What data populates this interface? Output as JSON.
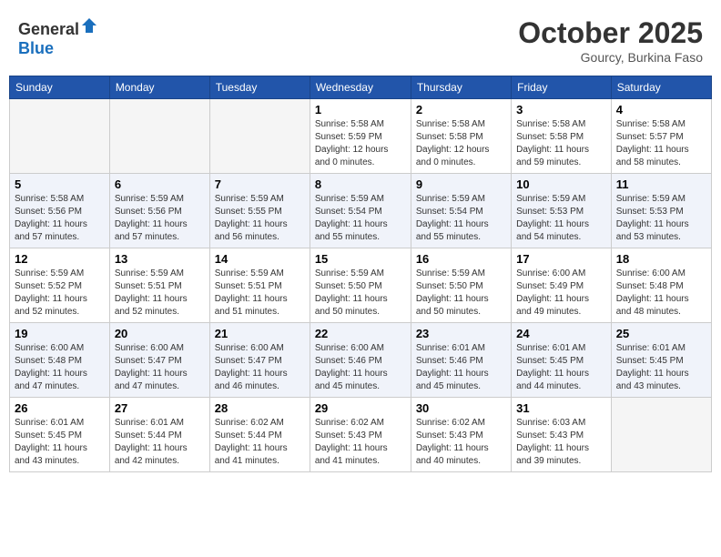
{
  "header": {
    "logo_general": "General",
    "logo_blue": "Blue",
    "month": "October 2025",
    "location": "Gourcy, Burkina Faso"
  },
  "weekdays": [
    "Sunday",
    "Monday",
    "Tuesday",
    "Wednesday",
    "Thursday",
    "Friday",
    "Saturday"
  ],
  "weeks": [
    [
      {
        "day": "",
        "info": ""
      },
      {
        "day": "",
        "info": ""
      },
      {
        "day": "",
        "info": ""
      },
      {
        "day": "1",
        "info": "Sunrise: 5:58 AM\nSunset: 5:59 PM\nDaylight: 12 hours\nand 0 minutes."
      },
      {
        "day": "2",
        "info": "Sunrise: 5:58 AM\nSunset: 5:58 PM\nDaylight: 12 hours\nand 0 minutes."
      },
      {
        "day": "3",
        "info": "Sunrise: 5:58 AM\nSunset: 5:58 PM\nDaylight: 11 hours\nand 59 minutes."
      },
      {
        "day": "4",
        "info": "Sunrise: 5:58 AM\nSunset: 5:57 PM\nDaylight: 11 hours\nand 58 minutes."
      }
    ],
    [
      {
        "day": "5",
        "info": "Sunrise: 5:58 AM\nSunset: 5:56 PM\nDaylight: 11 hours\nand 57 minutes."
      },
      {
        "day": "6",
        "info": "Sunrise: 5:59 AM\nSunset: 5:56 PM\nDaylight: 11 hours\nand 57 minutes."
      },
      {
        "day": "7",
        "info": "Sunrise: 5:59 AM\nSunset: 5:55 PM\nDaylight: 11 hours\nand 56 minutes."
      },
      {
        "day": "8",
        "info": "Sunrise: 5:59 AM\nSunset: 5:54 PM\nDaylight: 11 hours\nand 55 minutes."
      },
      {
        "day": "9",
        "info": "Sunrise: 5:59 AM\nSunset: 5:54 PM\nDaylight: 11 hours\nand 55 minutes."
      },
      {
        "day": "10",
        "info": "Sunrise: 5:59 AM\nSunset: 5:53 PM\nDaylight: 11 hours\nand 54 minutes."
      },
      {
        "day": "11",
        "info": "Sunrise: 5:59 AM\nSunset: 5:53 PM\nDaylight: 11 hours\nand 53 minutes."
      }
    ],
    [
      {
        "day": "12",
        "info": "Sunrise: 5:59 AM\nSunset: 5:52 PM\nDaylight: 11 hours\nand 52 minutes."
      },
      {
        "day": "13",
        "info": "Sunrise: 5:59 AM\nSunset: 5:51 PM\nDaylight: 11 hours\nand 52 minutes."
      },
      {
        "day": "14",
        "info": "Sunrise: 5:59 AM\nSunset: 5:51 PM\nDaylight: 11 hours\nand 51 minutes."
      },
      {
        "day": "15",
        "info": "Sunrise: 5:59 AM\nSunset: 5:50 PM\nDaylight: 11 hours\nand 50 minutes."
      },
      {
        "day": "16",
        "info": "Sunrise: 5:59 AM\nSunset: 5:50 PM\nDaylight: 11 hours\nand 50 minutes."
      },
      {
        "day": "17",
        "info": "Sunrise: 6:00 AM\nSunset: 5:49 PM\nDaylight: 11 hours\nand 49 minutes."
      },
      {
        "day": "18",
        "info": "Sunrise: 6:00 AM\nSunset: 5:48 PM\nDaylight: 11 hours\nand 48 minutes."
      }
    ],
    [
      {
        "day": "19",
        "info": "Sunrise: 6:00 AM\nSunset: 5:48 PM\nDaylight: 11 hours\nand 47 minutes."
      },
      {
        "day": "20",
        "info": "Sunrise: 6:00 AM\nSunset: 5:47 PM\nDaylight: 11 hours\nand 47 minutes."
      },
      {
        "day": "21",
        "info": "Sunrise: 6:00 AM\nSunset: 5:47 PM\nDaylight: 11 hours\nand 46 minutes."
      },
      {
        "day": "22",
        "info": "Sunrise: 6:00 AM\nSunset: 5:46 PM\nDaylight: 11 hours\nand 45 minutes."
      },
      {
        "day": "23",
        "info": "Sunrise: 6:01 AM\nSunset: 5:46 PM\nDaylight: 11 hours\nand 45 minutes."
      },
      {
        "day": "24",
        "info": "Sunrise: 6:01 AM\nSunset: 5:45 PM\nDaylight: 11 hours\nand 44 minutes."
      },
      {
        "day": "25",
        "info": "Sunrise: 6:01 AM\nSunset: 5:45 PM\nDaylight: 11 hours\nand 43 minutes."
      }
    ],
    [
      {
        "day": "26",
        "info": "Sunrise: 6:01 AM\nSunset: 5:45 PM\nDaylight: 11 hours\nand 43 minutes."
      },
      {
        "day": "27",
        "info": "Sunrise: 6:01 AM\nSunset: 5:44 PM\nDaylight: 11 hours\nand 42 minutes."
      },
      {
        "day": "28",
        "info": "Sunrise: 6:02 AM\nSunset: 5:44 PM\nDaylight: 11 hours\nand 41 minutes."
      },
      {
        "day": "29",
        "info": "Sunrise: 6:02 AM\nSunset: 5:43 PM\nDaylight: 11 hours\nand 41 minutes."
      },
      {
        "day": "30",
        "info": "Sunrise: 6:02 AM\nSunset: 5:43 PM\nDaylight: 11 hours\nand 40 minutes."
      },
      {
        "day": "31",
        "info": "Sunrise: 6:03 AM\nSunset: 5:43 PM\nDaylight: 11 hours\nand 39 minutes."
      },
      {
        "day": "",
        "info": ""
      }
    ]
  ]
}
